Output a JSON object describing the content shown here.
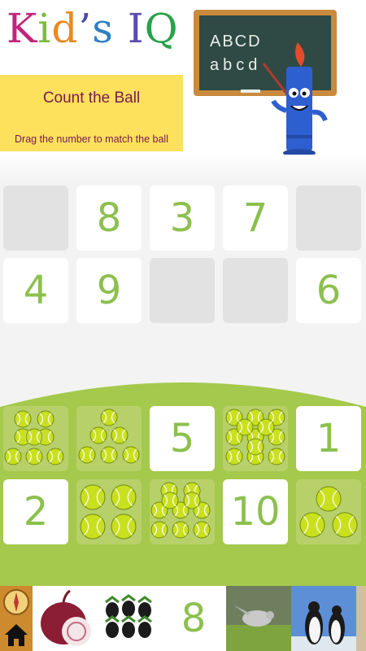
{
  "header": {
    "logo_letters": [
      "K",
      "i",
      "d",
      "’",
      "s",
      " ",
      "I",
      "Q"
    ],
    "logo_colors": [
      "#c2257b",
      "#7cbb3a",
      "#e88a23",
      "#4b4ba8",
      "#2f7fc2",
      "#ffffff",
      "#5a4bb0",
      "#2aa14a"
    ],
    "title": "Count the Ball",
    "instruction": "Drag the number to match the ball",
    "board_line1": "ABCD",
    "board_line2": "abcd"
  },
  "targets": {
    "row1": [
      "",
      "8",
      "3",
      "7",
      ""
    ],
    "row2": [
      "4",
      "9",
      "",
      "",
      "6"
    ]
  },
  "puzzle": {
    "row1": [
      {
        "type": "balls",
        "count": 8
      },
      {
        "type": "balls",
        "count": 6
      },
      {
        "type": "number",
        "value": "5"
      },
      {
        "type": "balls",
        "count": 12
      },
      {
        "type": "number",
        "value": "1"
      }
    ],
    "row2": [
      {
        "type": "number",
        "value": "2"
      },
      {
        "type": "balls",
        "count": 4
      },
      {
        "type": "balls",
        "count": 10
      },
      {
        "type": "number",
        "value": "10"
      },
      {
        "type": "balls",
        "count": 3
      }
    ]
  },
  "bottom_bar": {
    "menu_icon": "compass-icon",
    "home_icon": "home-icon",
    "items": [
      "onion-image",
      "blackberries-image",
      "8",
      "bird-image",
      "penguins-image"
    ]
  },
  "colors": {
    "number_green": "#8cc04e",
    "tile_green": "#b8d06a",
    "panel_yellow": "#fde05c",
    "title_text": "#7a1a4f"
  }
}
